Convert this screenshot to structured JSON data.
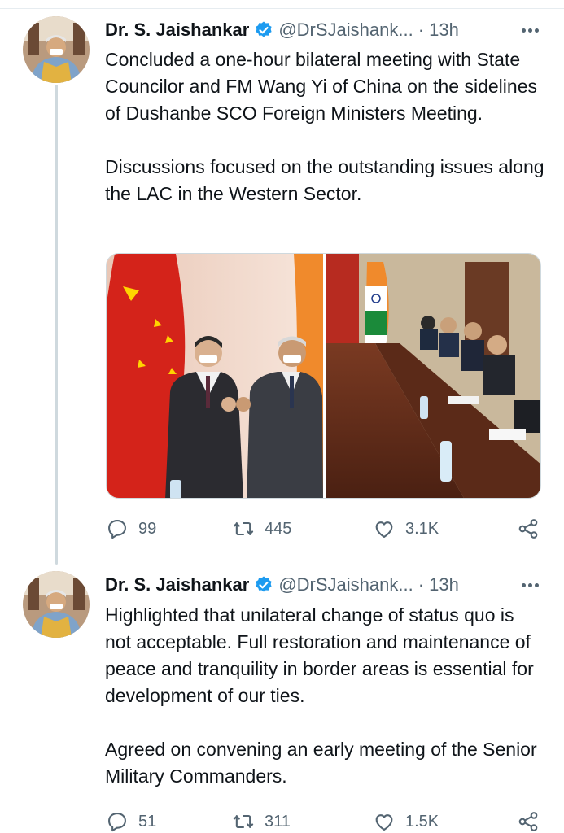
{
  "tweets": [
    {
      "author_name": "Dr. S. Jaishankar",
      "handle": "@DrSJaishank...",
      "time": "· 13h",
      "text": "Concluded a one-hour bilateral meeting with State Councilor and FM Wang Yi of China on the sidelines of Dushanbe SCO Foreign Ministers Meeting.\n\nDiscussions focused on the outstanding issues along the LAC in the Western Sector.",
      "replies": "99",
      "retweets": "445",
      "likes": "3.1K"
    },
    {
      "author_name": "Dr. S. Jaishankar",
      "handle": "@DrSJaishank...",
      "time": "· 13h",
      "text": "Highlighted that unilateral change of status quo is not acceptable. Full restoration and maintenance of peace and tranquility in border areas is essential for development of our ties.\n\nAgreed on convening  an early meeting of the Senior Military Commanders.",
      "replies": "51",
      "retweets": "311",
      "likes": "1.5K"
    }
  ],
  "icons": {
    "verified": "verified-badge-icon",
    "more": "more-options-icon",
    "reply": "reply-icon",
    "retweet": "retweet-icon",
    "like": "heart-icon",
    "share": "share-icon"
  },
  "colors": {
    "verified_blue": "#1d9bf0",
    "secondary_text": "#536471",
    "thread_line": "#cfd9de"
  }
}
